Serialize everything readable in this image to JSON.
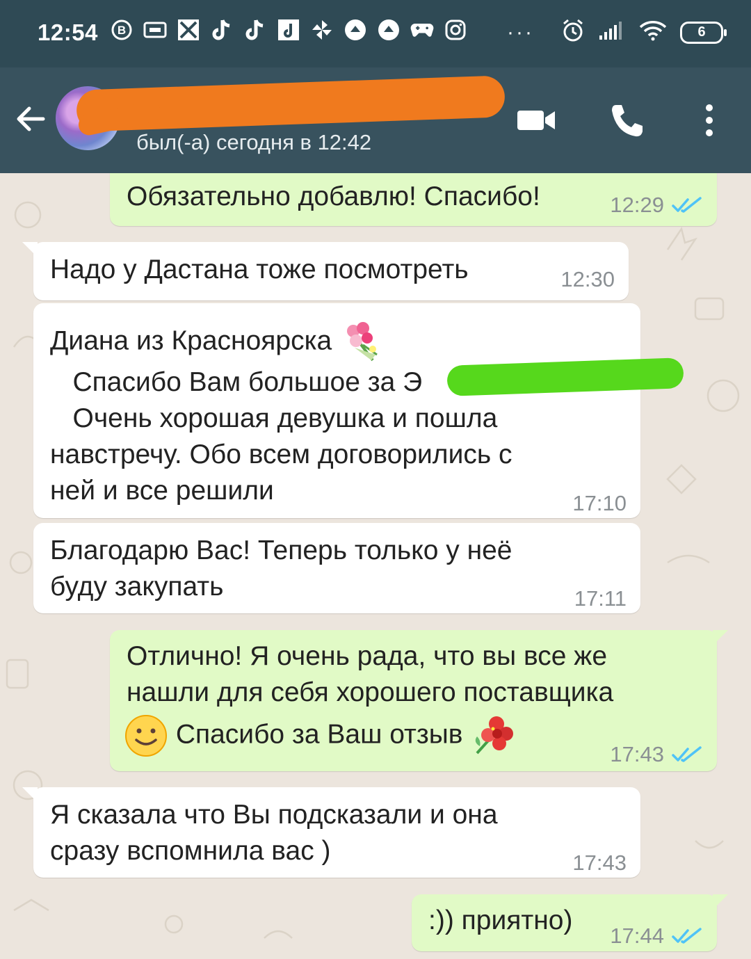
{
  "status_bar": {
    "time": "12:54",
    "battery": "6",
    "more": "···",
    "icons": [
      "b-circle-icon",
      "cassette-icon",
      "app-icon",
      "tiktok-icon",
      "tiktok-icon",
      "app-icon",
      "pinwheel-icon",
      "circle-app-icon",
      "circle-app-icon",
      "gamepad-icon",
      "instagram-icon",
      "alarm-icon",
      "signal-icon",
      "wifi-icon",
      "battery-icon"
    ]
  },
  "header": {
    "last_seen": "был(-а) сегодня в 12:42",
    "name_redacted": true
  },
  "colors": {
    "statusbar": "#2f4a55",
    "appbar": "#38525e",
    "incoming": "#ffffff",
    "outgoing": "#e1fac6",
    "ticks": "#4fc3f7",
    "redact_orange": "#f07a1e",
    "redact_green": "#56d81c"
  },
  "messages": [
    {
      "direction": "out",
      "text": "Обязательно добавлю! Спасибо!",
      "time": "12:29",
      "read": true
    },
    {
      "direction": "in",
      "text": "Надо у Дастана тоже посмотреть",
      "time": "12:30"
    },
    {
      "direction": "in",
      "line1": "Диана из Красноярска",
      "line2": "   Спасибо Вам большое за Э",
      "line3": "   Очень хорошая девушка и пошла\nнавстречу. Обо всем договорились с\nней и все решили",
      "time": "17:10",
      "emoji": "bouquet-icon"
    },
    {
      "direction": "in",
      "text": "Благодарю Вас! Теперь только у неё\nбуду закупать",
      "time": "17:11"
    },
    {
      "direction": "out",
      "line1": "Отлично! Я очень рада, что вы все же\nнашли для себя хорошего поставщика",
      "line2": " Спасибо за Ваш отзыв ",
      "time": "17:43",
      "read": true,
      "emoji": [
        "smile-icon",
        "hibiscus-icon"
      ]
    },
    {
      "direction": "in",
      "text": "Я сказала что Вы подсказали и она\nсразу вспомнила вас )",
      "time": "17:43"
    },
    {
      "direction": "out",
      "text": ":)) приятно)",
      "time": "17:44",
      "read": true
    }
  ]
}
